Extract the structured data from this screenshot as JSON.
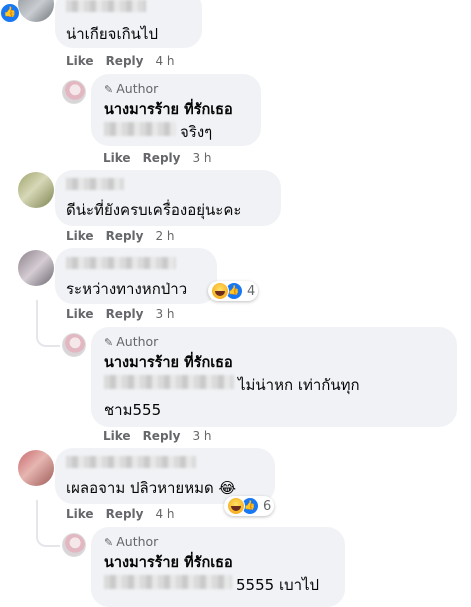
{
  "labels": {
    "like": "Like",
    "reply": "Reply"
  },
  "comments": [
    {
      "text": "น่าเกียจเกินไป",
      "time": "4 h"
    },
    {
      "text": "ดีน่ะที่ยังครบเครื่องอยุ่นะคะ",
      "time": "2 h"
    },
    {
      "text": "ระหว่างทางหกป่าว",
      "time": "3 h",
      "reaction_count": "4"
    },
    {
      "text": "เผลอจาม ปลิวหายหมด",
      "emoji_after": "😂",
      "time": "4 h",
      "reaction_count": "6"
    }
  ],
  "replies": [
    {
      "badge": "Author",
      "name": "นางมารร้าย ที่รักเธอ",
      "text": "จริงๆ",
      "time": "3 h"
    },
    {
      "badge": "Author",
      "name": "นางมารร้าย ที่รักเธอ",
      "text_line1": "ไม่น่าหก เท่ากันทุก",
      "text_line2": "ชาม555",
      "time": "3 h"
    },
    {
      "badge": "Author",
      "name": "นางมารร้าย ที่รักเธอ",
      "text": "5555 เบาไป"
    }
  ],
  "icons": {
    "like_reaction": "thumbs-up-icon",
    "haha_reaction": "laughing-face-icon",
    "pencil": "pencil-icon"
  },
  "colors": {
    "bubble": "#f0f2f5",
    "like_blue": "#1877f2",
    "meta_gray": "#65676b"
  }
}
